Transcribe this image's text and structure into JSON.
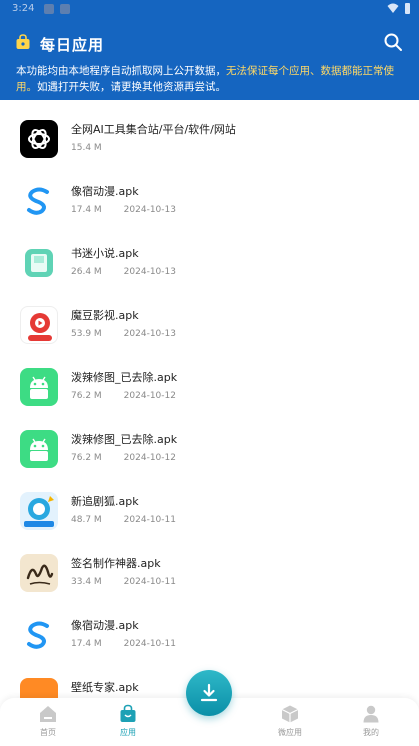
{
  "status_bar": {
    "time": "3:24"
  },
  "header": {
    "title": "每日应用",
    "notice_normal": "本功能均由本地程序自动抓取网上公开数据，",
    "notice_warn": "无法保证每个应用、数据都能正常使用。",
    "notice_tail": "如遇打开失败，请更换其他资源再尝试。"
  },
  "apps": [
    {
      "name": "全网AI工具集合站/平台/软件/网站",
      "size": "15.4 M",
      "date": "",
      "icon": "openai-icon"
    },
    {
      "name": "像宿动漫.apk",
      "size": "17.4 M",
      "date": "2024-10-13",
      "icon": "s-logo-icon"
    },
    {
      "name": "书迷小说.apk",
      "size": "26.4 M",
      "date": "2024-10-13",
      "icon": "book-icon"
    },
    {
      "name": "魔豆影视.apk",
      "size": "53.9 M",
      "date": "2024-10-13",
      "icon": "video-icon"
    },
    {
      "name": "泼辣修图_已去除.apk",
      "size": "76.2 M",
      "date": "2024-10-12",
      "icon": "android-icon"
    },
    {
      "name": "泼辣修图_已去除.apk",
      "size": "76.2 M",
      "date": "2024-10-12",
      "icon": "android-icon"
    },
    {
      "name": "新追剧狐.apk",
      "size": "48.7 M",
      "date": "2024-10-11",
      "icon": "fox-icon"
    },
    {
      "name": "签名制作神器.apk",
      "size": "33.4 M",
      "date": "2024-10-11",
      "icon": "signature-icon"
    },
    {
      "name": "像宿动漫.apk",
      "size": "17.4 M",
      "date": "2024-10-11",
      "icon": "s-logo-icon"
    },
    {
      "name": "壁纸专家.apk",
      "size": "",
      "date": "",
      "icon": "wallpaper-icon"
    }
  ],
  "nav": {
    "home": "首页",
    "apps": "应用",
    "micro_apps": "微应用",
    "mine": "我的",
    "active_color": "#1da1b5"
  },
  "colors": {
    "header": "#1565c0",
    "accent": "#1da1b5",
    "warn_text": "#ffd966"
  }
}
